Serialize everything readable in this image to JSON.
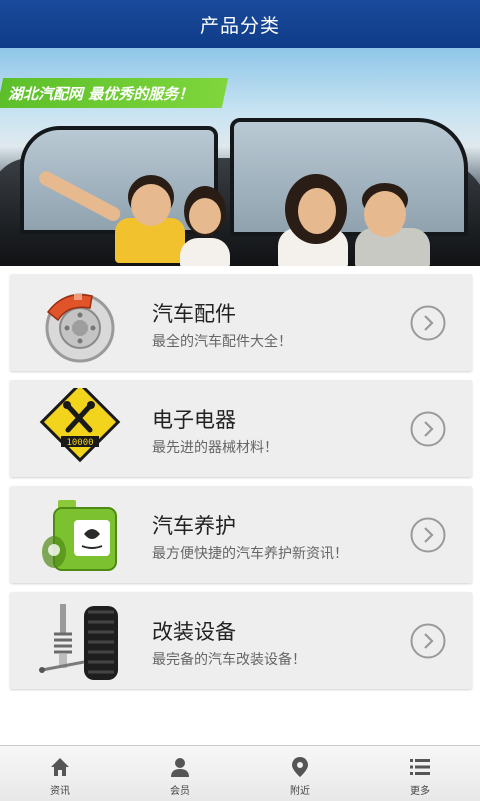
{
  "header": {
    "title": "产品分类"
  },
  "banner": {
    "tagline": "湖北汽配网 最优秀的服务！"
  },
  "categories": [
    {
      "title": "汽车配件",
      "subtitle": "最全的汽车配件大全！",
      "icon": "brake-disc-icon"
    },
    {
      "title": "电子电器",
      "subtitle": "最先进的器械材料！",
      "icon": "tools-sign-icon",
      "sign_text": "10000"
    },
    {
      "title": "汽车养护",
      "subtitle": "最方便快捷的汽车养护新资讯！",
      "icon": "oil-can-icon"
    },
    {
      "title": "改装设备",
      "subtitle": "最完备的汽车改装设备！",
      "icon": "suspension-tire-icon"
    }
  ],
  "tabbar": [
    {
      "label": "资讯",
      "icon": "home-icon"
    },
    {
      "label": "会员",
      "icon": "user-icon"
    },
    {
      "label": "附近",
      "icon": "location-pin-icon"
    },
    {
      "label": "更多",
      "icon": "list-icon"
    }
  ],
  "colors": {
    "header": "#15449a",
    "accent_green": "#6cc934",
    "card_bg": "#eeeeee"
  }
}
